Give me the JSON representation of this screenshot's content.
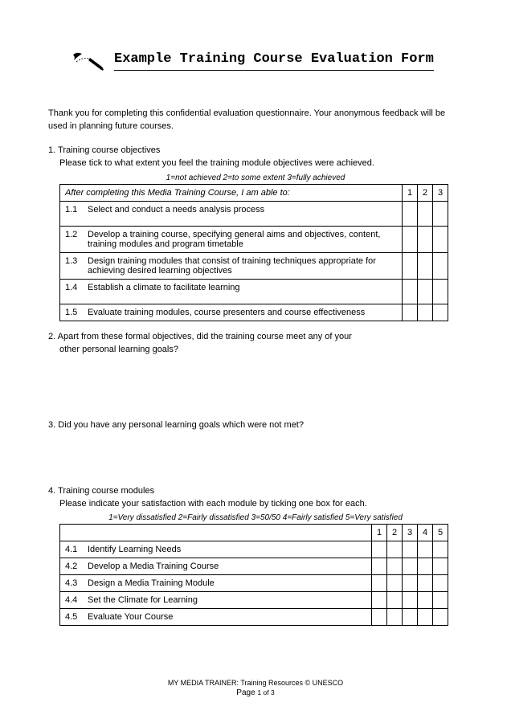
{
  "title": "Example Training Course Evaluation Form",
  "intro": "Thank you for completing this confidential evaluation questionnaire.  Your anonymous feedback will be used in planning future courses.",
  "q1": {
    "num": "1.",
    "title": "Training course objectives",
    "sub": "Please tick to what extent you feel the training module objectives were achieved.",
    "legend": "1=not achieved  2=to some extent 3=fully achieved",
    "header": "After completing this Media Training Course, I am able to:",
    "cols": [
      "1",
      "2",
      "3"
    ],
    "rows": [
      {
        "idx": "1.1",
        "text": "Select and conduct a needs analysis process"
      },
      {
        "idx": "1.2",
        "text": "Develop a training course, specifying general aims and objectives, content, training modules and program timetable"
      },
      {
        "idx": "1.3",
        "text": "Design training modules that consist of training techniques appropriate for achieving desired learning objectives"
      },
      {
        "idx": "1.4",
        "text": "Establish a climate to facilitate learning"
      },
      {
        "idx": "1.5",
        "text": "Evaluate training modules, course presenters and course effectiveness"
      }
    ]
  },
  "q2": {
    "num": "2.",
    "text": "Apart from these formal objectives, did the training course meet any of your other personal learning goals?"
  },
  "q3": {
    "num": "3.",
    "text": "Did you have any personal learning goals which were not met?"
  },
  "q4": {
    "num": "4.",
    "title": "Training course modules",
    "sub": "Please indicate your satisfaction with each module by ticking one box for each.",
    "legend": "1=Very dissatisfied 2=Fairly dissatisfied 3=50/50 4=Fairly satisfied 5=Very satisfied",
    "cols": [
      "1",
      "2",
      "3",
      "4",
      "5"
    ],
    "rows": [
      {
        "idx": "4.1",
        "text": "Identify Learning Needs"
      },
      {
        "idx": "4.2",
        "text": "Develop a Media Training Course"
      },
      {
        "idx": "4.3",
        "text": "Design a Media Training Module"
      },
      {
        "idx": "4.4",
        "text": "Set the Climate for Learning"
      },
      {
        "idx": "4.5",
        "text": "Evaluate Your Course"
      }
    ]
  },
  "footer": {
    "line": "MY MEDIA TRAINER: Training Resources © UNESCO",
    "page_label": "Page",
    "page_value": "1 of 3"
  }
}
